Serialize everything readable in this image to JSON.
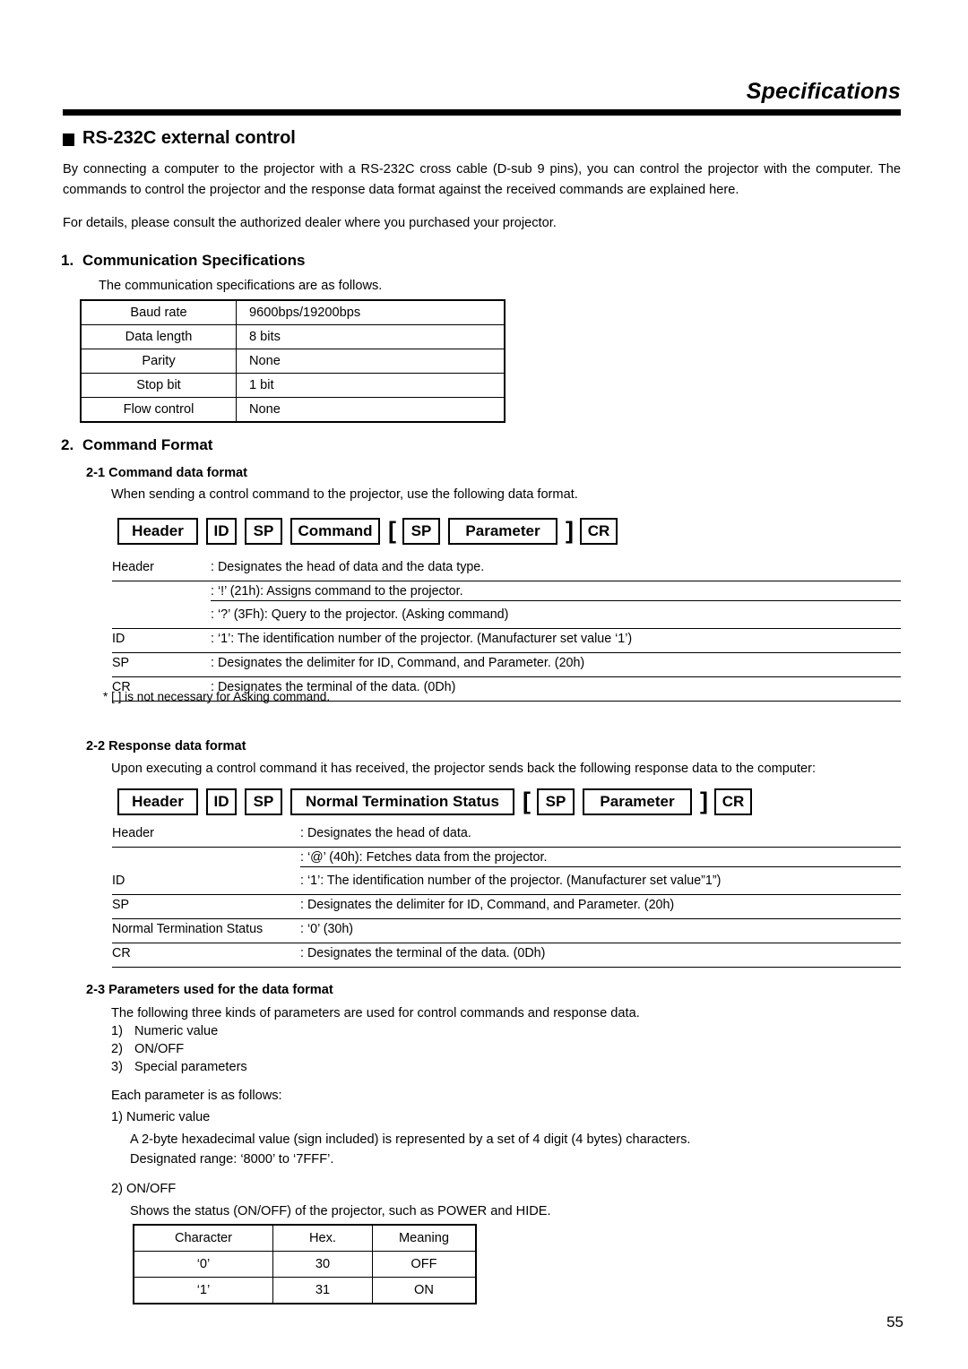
{
  "running_head": "Specifications",
  "section": {
    "bullet_icon": "filled-square-bullet",
    "title": "RS-232C external control",
    "intro_paragraph": "By connecting a computer to the projector with a RS-232C cross cable (D-sub 9 pins), you can control the projector with the computer. The commands to control the projector and the response data format against the received commands are explained here.",
    "intro_paragraph2": "For details, please consult the authorized dealer where you purchased your projector."
  },
  "comm_spec": {
    "number": "1.",
    "heading": "Communication Specifications",
    "lead": "The communication specifications are as follows.",
    "rows": [
      {
        "label": "Baud rate",
        "value": "9600bps/19200bps"
      },
      {
        "label": "Data length",
        "value": "8 bits"
      },
      {
        "label": "Parity",
        "value": "None"
      },
      {
        "label": "Stop bit",
        "value": "1 bit"
      },
      {
        "label": "Flow control",
        "value": "None"
      }
    ]
  },
  "command_format": {
    "number": "2.",
    "heading": "Command Format",
    "cmd_data": {
      "sub_number": "2-1",
      "sub_heading": "Command data format",
      "lead": "When sending a control command to the projector, use the following data format.",
      "diagram": {
        "header": "Header",
        "id": "ID",
        "sp1": "SP",
        "command": "Command",
        "bracket_open": "[",
        "sp2": "SP",
        "parameter": "Parameter",
        "bracket_close": "]",
        "cr": "CR"
      },
      "defs": [
        {
          "term": "Header",
          "desc": ": Designates the head of data and the data type."
        },
        {
          "term": "",
          "desc": ": ‘!’ (21h): Assigns command to the projector."
        },
        {
          "term": "",
          "desc": ": ‘?’ (3Fh): Query to the projector. (Asking command)"
        },
        {
          "term": "ID",
          "desc": ": ‘1’: The identification number of the projector. (Manufacturer set value ‘1’)"
        },
        {
          "term": "SP",
          "desc": ": Designates the delimiter for ID, Command, and Parameter. (20h)"
        },
        {
          "term": "CR",
          "desc": ": Designates the terminal of the data. (0Dh)"
        }
      ],
      "note": "* [  ] is not necessary for Asking command."
    },
    "response_data": {
      "sub_number": "2-2",
      "sub_heading": "Response data format",
      "lead": "Upon executing a control command it has received, the projector sends back the following response data to the computer:",
      "diagram": {
        "header": "Header",
        "id": "ID",
        "sp1": "SP",
        "status": "Normal Termination Status",
        "bracket_open": "[",
        "sp2": "SP",
        "parameter": "Parameter",
        "bracket_close": "]",
        "cr": "CR"
      },
      "defs": [
        {
          "term": "Header",
          "desc": ": Designates the head of data."
        },
        {
          "term": "",
          "desc": ": ‘@’ (40h): Fetches data from the projector."
        },
        {
          "term": "ID",
          "desc": ": ‘1’: The identification number of the projector. (Manufacturer set value”1”)"
        },
        {
          "term": "SP",
          "desc": ":  Designates the delimiter for ID, Command, and Parameter. (20h)"
        },
        {
          "term": "Normal Termination Status",
          "desc": ": ‘0’ (30h)"
        },
        {
          "term": "CR",
          "desc": ": Designates the terminal of the data. (0Dh)"
        }
      ]
    },
    "parameters": {
      "sub_number": "2-3",
      "sub_heading": "Parameters used for the data format",
      "lead": "The following three kinds of parameters are used for control commands and response data.",
      "kinds": [
        {
          "marker": "1)",
          "label": "Numeric value"
        },
        {
          "marker": "2)",
          "label": "ON/OFF"
        },
        {
          "marker": "3)",
          "label": "Special parameters"
        }
      ],
      "each_lead": "Each parameter is as follows:",
      "numeric": {
        "title": "1) Numeric value",
        "line1": "A 2-byte hexadecimal value (sign included) is represented by a set of 4 digit (4 bytes) characters.",
        "line2": "Designated range: ‘8000’ to ‘7FFF’."
      },
      "onoff": {
        "title": "2) ON/OFF",
        "lead": "Shows the status (ON/OFF) of the projector, such as POWER and HIDE.",
        "columns": [
          "Character",
          "Hex.",
          "Meaning"
        ],
        "rows": [
          [
            "‘0’",
            "30",
            "OFF"
          ],
          [
            "‘1’",
            "31",
            "ON"
          ]
        ]
      }
    }
  },
  "page_number": "55"
}
